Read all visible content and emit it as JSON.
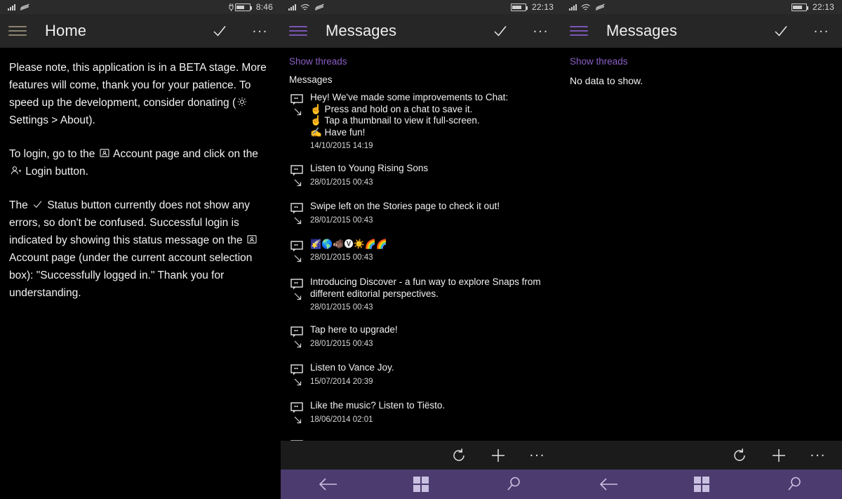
{
  "meta": {
    "accent_purple": "#7b55b5",
    "link_purple": "#8a5fc4",
    "nav_purple": "#4b3b6e",
    "header_bg": "#262626",
    "statusbar_bg": "#2b2b2b",
    "bottombar_bg": "#1b1b1b",
    "hamburger_tan": "#8b8470"
  },
  "panel_left": {
    "statusbar": {
      "time": "8:46",
      "icons": [
        "signal-icon",
        "data-waves-icon",
        "battery-charging-icon"
      ]
    },
    "appbar": {
      "menu_icon": "hamburger-icon",
      "title": "Home",
      "status_icon": "checkmark-icon",
      "more_icon": "ellipsis-icon",
      "more_label": "..."
    },
    "paragraphs": [
      {
        "id": "beta-notice",
        "parts": [
          {
            "type": "text",
            "value": "Please note, this application is in a BETA stage. More features will come, thank you for your patience. To speed up the development, consider donating ("
          },
          {
            "type": "icon",
            "name": "gear-icon"
          },
          {
            "type": "text",
            "value": " Settings > About)."
          }
        ]
      },
      {
        "id": "login-instructions",
        "parts": [
          {
            "type": "text",
            "value": "To login, go to the "
          },
          {
            "type": "icon",
            "name": "contact-card-icon"
          },
          {
            "type": "text",
            "value": " Account page and click on the "
          },
          {
            "type": "icon",
            "name": "add-person-icon"
          },
          {
            "type": "text",
            "value": " Login button."
          }
        ]
      },
      {
        "id": "status-explanation",
        "parts": [
          {
            "type": "text",
            "value": "The "
          },
          {
            "type": "icon",
            "name": "checkmark-icon"
          },
          {
            "type": "text",
            "value": " Status button currently does not show any errors, so don't be confused. Successful login is indicated by showing this status message on the "
          },
          {
            "type": "icon",
            "name": "contact-card-icon"
          },
          {
            "type": "text",
            "value": " Account page (under the current account selection box): \"Successfully logged in.\" Thank you for understanding."
          }
        ]
      }
    ]
  },
  "panel_mid": {
    "statusbar": {
      "time": "22:13",
      "icons": [
        "signal-icon",
        "wifi-icon",
        "data-waves-icon",
        "battery-icon"
      ]
    },
    "appbar": {
      "menu_icon": "hamburger-icon",
      "title": "Messages",
      "status_icon": "checkmark-icon",
      "more_icon": "ellipsis-icon",
      "more_label": "..."
    },
    "show_threads_link": "Show threads",
    "section_label": "Messages",
    "messages": [
      {
        "lines": [
          "Hey! We've made some improvements to Chat:",
          "☝ Press and hold on a chat to save it.",
          "☝ Tap a thumbnail to view it full-screen.",
          "✍ Have fun!"
        ],
        "date": "14/10/2015 14:19",
        "emoji": false
      },
      {
        "lines": [
          "Listen to Young Rising Sons"
        ],
        "date": "28/01/2015 00:43",
        "emoji": false
      },
      {
        "lines": [
          "Swipe left on the Stories page to check it out!"
        ],
        "date": "28/01/2015 00:43",
        "emoji": false
      },
      {
        "lines": [
          "🌠🌎🐗🅥☀️🌈🌈"
        ],
        "date": "28/01/2015 00:43",
        "emoji": true
      },
      {
        "lines": [
          "Introducing Discover - a fun way to explore Snaps from different editorial perspectives."
        ],
        "date": "28/01/2015 00:43",
        "emoji": false
      },
      {
        "lines": [
          "Tap here to upgrade!"
        ],
        "date": "28/01/2015 00:43",
        "emoji": false
      },
      {
        "lines": [
          "Listen to Vance Joy."
        ],
        "date": "15/07/2014 20:39",
        "emoji": false
      },
      {
        "lines": [
          "Like the music? Listen to Tiësto."
        ],
        "date": "18/06/2014 02:01",
        "emoji": false
      }
    ],
    "bottombar": {
      "refresh_icon": "refresh-icon",
      "add_icon": "plus-icon",
      "more_icon": "ellipsis-icon",
      "more_label": "..."
    },
    "navbar": {
      "back_icon": "back-arrow-icon",
      "start_icon": "windows-logo-icon",
      "search_icon": "search-icon"
    }
  },
  "panel_right": {
    "statusbar": {
      "time": "22:13",
      "icons": [
        "signal-icon",
        "wifi-icon",
        "data-waves-icon",
        "battery-icon"
      ]
    },
    "appbar": {
      "menu_icon": "hamburger-icon",
      "title": "Messages",
      "status_icon": "checkmark-icon",
      "more_icon": "ellipsis-icon",
      "more_label": "..."
    },
    "show_threads_link": "Show threads",
    "empty_state": "No data to show.",
    "bottombar": {
      "refresh_icon": "refresh-icon",
      "add_icon": "plus-icon",
      "more_icon": "ellipsis-icon",
      "more_label": "..."
    },
    "navbar": {
      "back_icon": "back-arrow-icon",
      "start_icon": "windows-logo-icon",
      "search_icon": "search-icon"
    }
  }
}
